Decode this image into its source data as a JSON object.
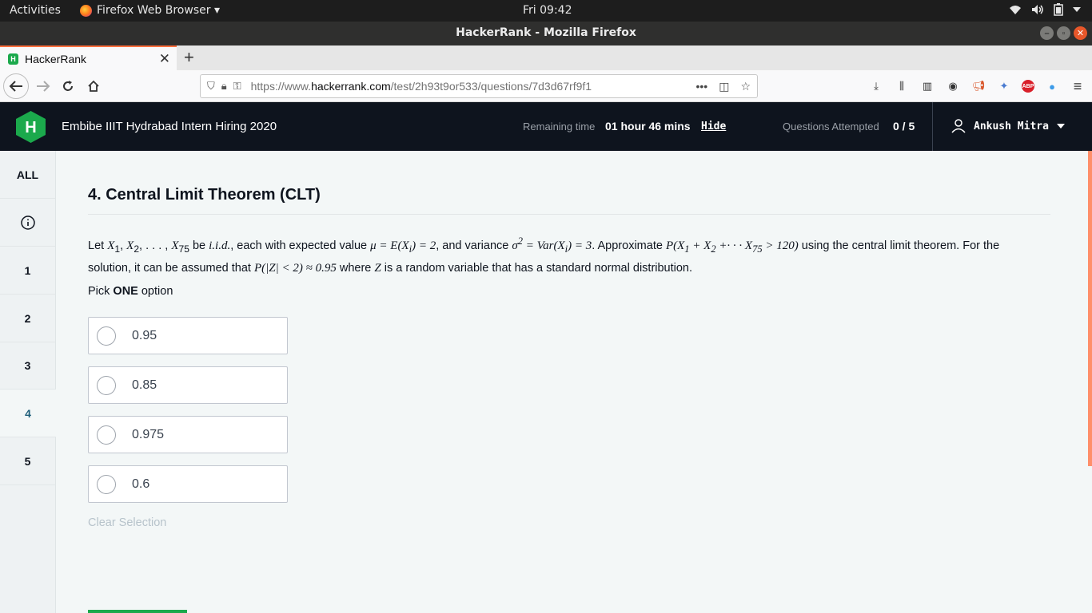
{
  "system": {
    "activities": "Activities",
    "app_menu": "Firefox Web Browser ▾",
    "clock": "Fri 09:42"
  },
  "window": {
    "title": "HackerRank - Mozilla Firefox"
  },
  "browser": {
    "tab_title": "HackerRank",
    "url_prefix": "https://www.",
    "url_domain": "hackerrank.com",
    "url_path": "/test/2h93t9or533/questions/7d3d67rf9f1"
  },
  "header": {
    "test_title": "Embibe IIIT Hydrabad Intern Hiring 2020",
    "remaining_label": "Remaining time",
    "remaining_value": "01 hour 46 mins",
    "hide_label": "Hide",
    "attempted_label": "Questions Attempted",
    "attempted_value": "0 / 5",
    "user_name": "Ankush Mitra"
  },
  "sidebar": {
    "all_label": "ALL",
    "items": [
      "1",
      "2",
      "3",
      "4",
      "5"
    ],
    "active": "4"
  },
  "question": {
    "title": "4. Central Limit Theorem (CLT)",
    "pick_prefix": "Pick ",
    "pick_bold": "ONE",
    "pick_suffix": " option",
    "options": [
      "0.95",
      "0.85",
      "0.975",
      "0.6"
    ],
    "clear_label": "Clear Selection"
  },
  "colors": {
    "header_bg": "#0e141e",
    "brand_green": "#1ba94c",
    "page_bg": "#f3f7f7",
    "active_tab_accent": "#ff6f3d"
  }
}
